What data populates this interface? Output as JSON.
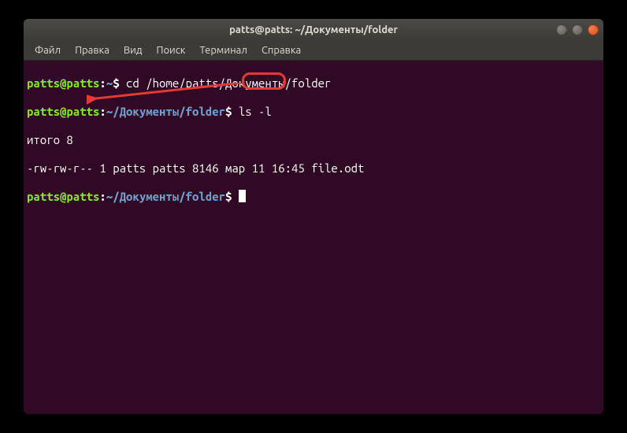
{
  "window": {
    "title": "patts@patts: ~/Документы/folder"
  },
  "menubar": {
    "items": [
      {
        "label": "Файл"
      },
      {
        "label": "Правка"
      },
      {
        "label": "Вид"
      },
      {
        "label": "Поиск"
      },
      {
        "label": "Терминал"
      },
      {
        "label": "Справка"
      }
    ]
  },
  "terminal": {
    "lines": [
      {
        "prompt": {
          "user_host": "patts@patts",
          "path": "~",
          "symbol": "$"
        },
        "command": "cd /home/patts/Документы/folder"
      },
      {
        "prompt": {
          "user_host": "patts@patts",
          "path": "~/Документы/folder",
          "symbol": "$"
        },
        "command": "ls -l"
      }
    ],
    "output": [
      "итого 8",
      "-rw-rw-r-- 1 patts patts 8146 мар 11 16:45 file.odt"
    ],
    "current_prompt": {
      "user_host": "patts@patts",
      "path": "~/Документы/folder",
      "symbol": "$"
    }
  },
  "annotations": {
    "highlight_color": "#e53935"
  }
}
